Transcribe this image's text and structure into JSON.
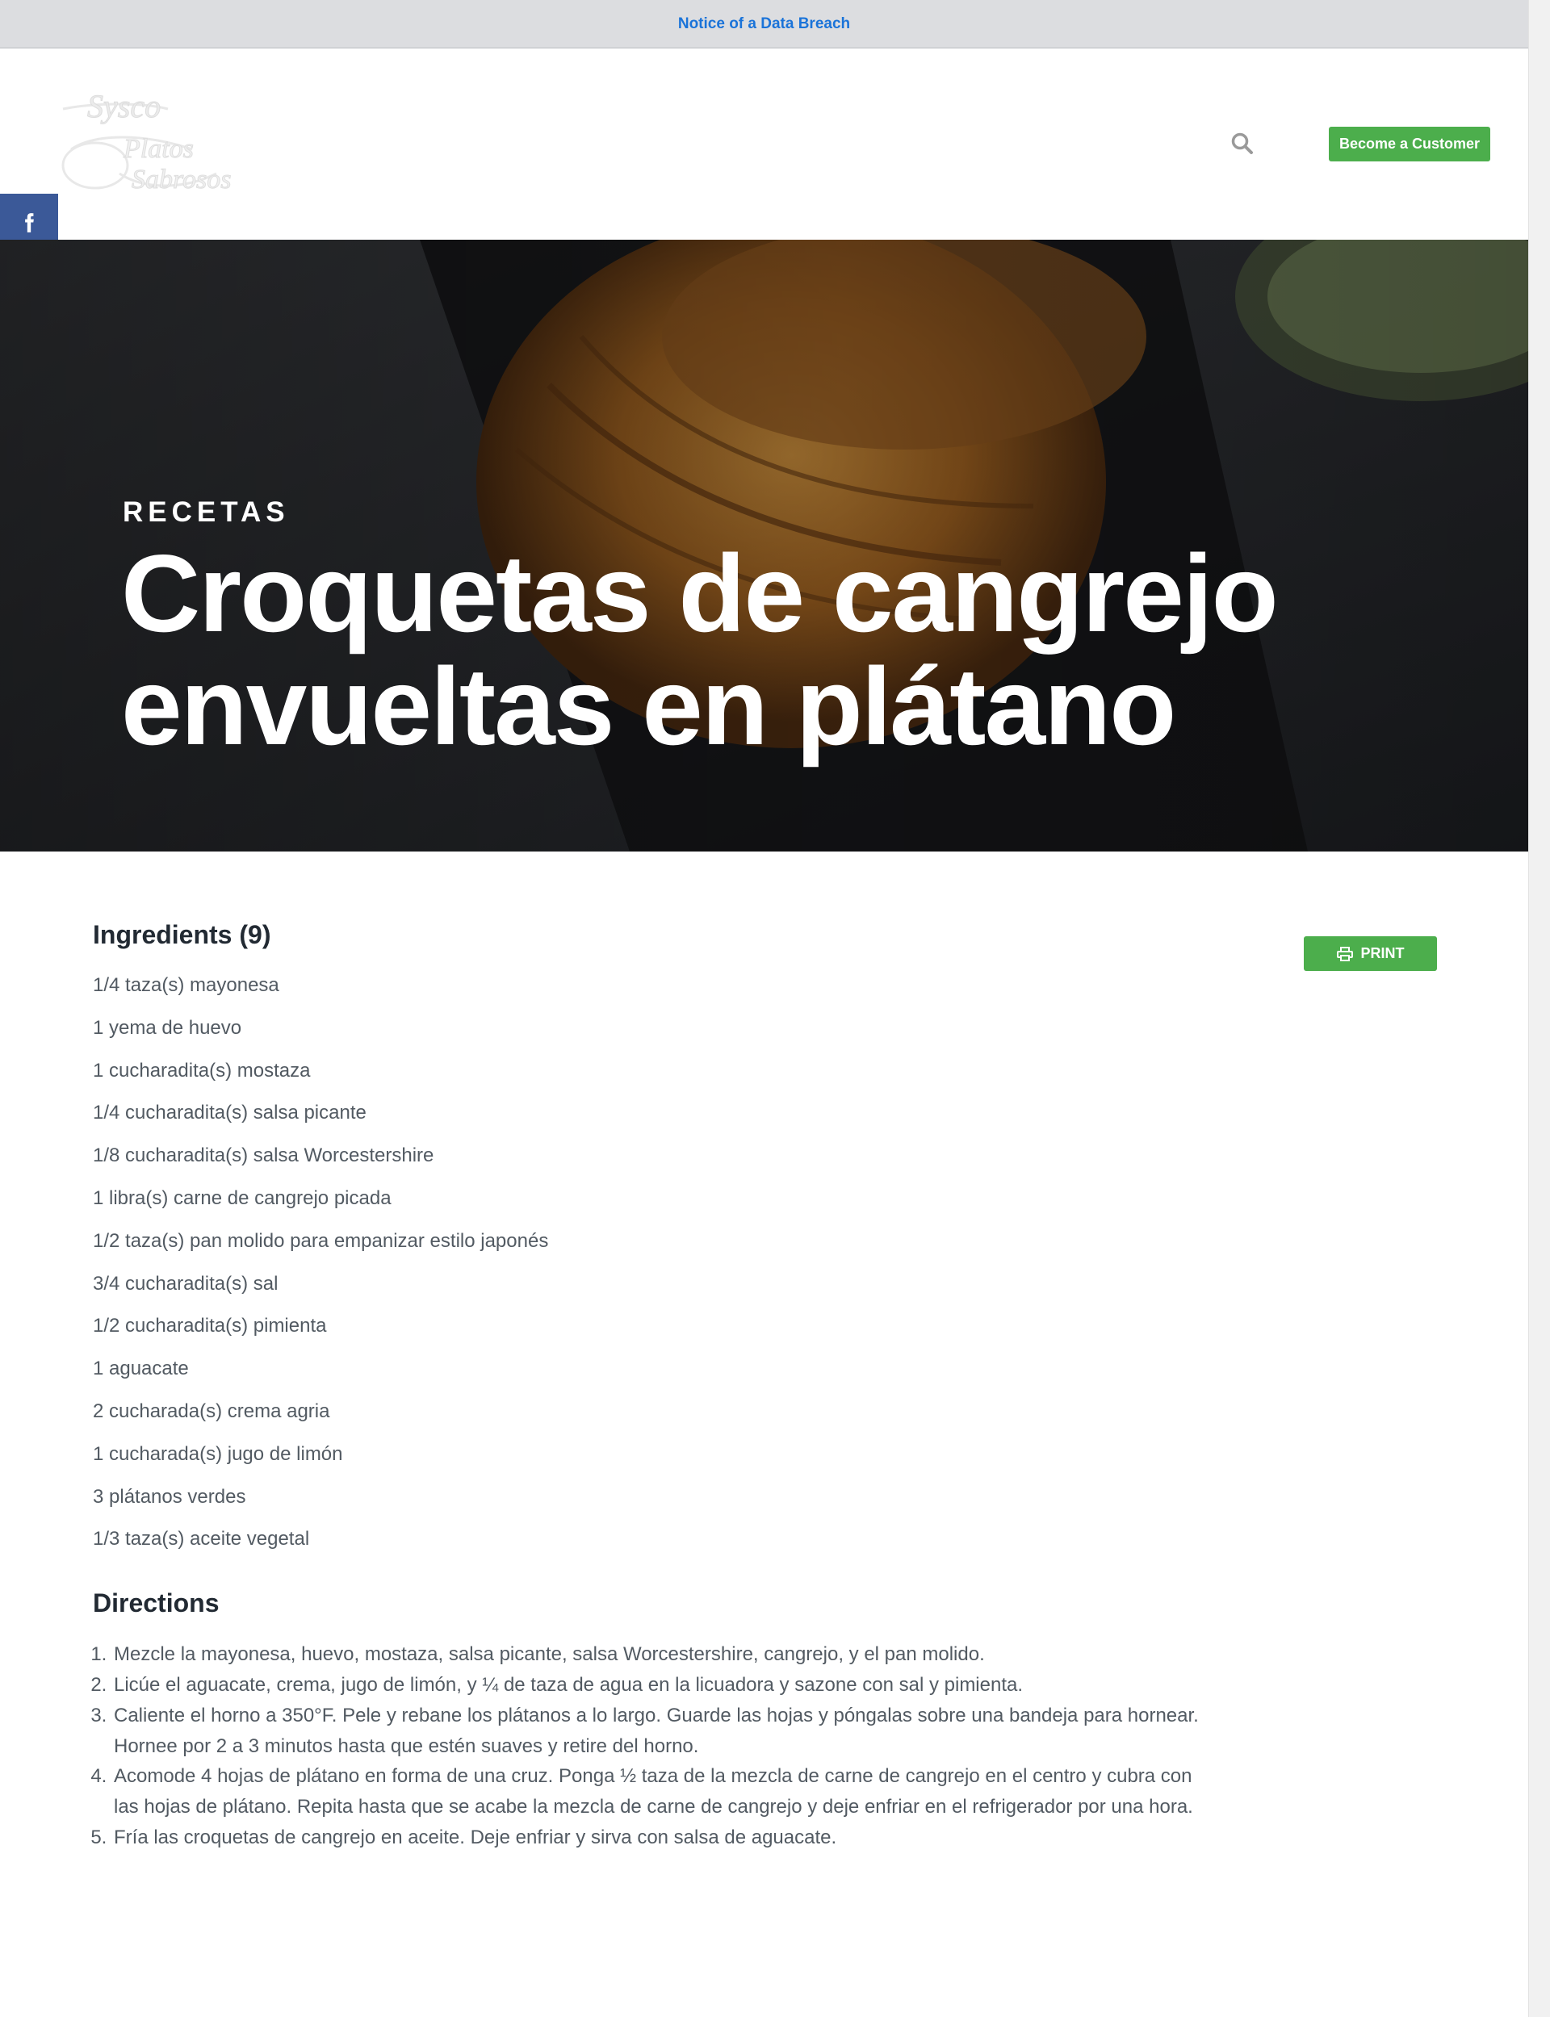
{
  "notice": {
    "link_text": "Notice of a Data Breach"
  },
  "header": {
    "cta_label": "Become a Customer"
  },
  "hero": {
    "eyebrow": "RECETAS",
    "title_line1": "Croquetas de cangrejo",
    "title_line2": "envueltas en plátano"
  },
  "social": {
    "icons": [
      "facebook-icon",
      "x-icon",
      "pinterest-icon",
      "email-icon",
      "share-icon"
    ]
  },
  "ingredients": {
    "title": "Ingredients (9)",
    "print_label": "PRINT",
    "items": [
      "1/4 taza(s) mayonesa",
      "1 yema de huevo",
      "1 cucharadita(s) mostaza",
      "1/4 cucharadita(s) salsa picante",
      "1/8 cucharadita(s) salsa Worcestershire",
      "1 libra(s) carne de cangrejo picada",
      "1/2 taza(s) pan molido para empanizar estilo japonés",
      "3/4 cucharadita(s) sal",
      "1/2 cucharadita(s) pimienta",
      "1 aguacate",
      "2 cucharada(s) crema agria",
      "1 cucharada(s) jugo de limón",
      "3 plátanos verdes",
      "1/3 taza(s) aceite vegetal"
    ]
  },
  "directions": {
    "title": "Directions",
    "steps": [
      "Mezcle la mayonesa, huevo, mostaza, salsa picante, salsa Worcestershire, cangrejo, y el pan molido.",
      "Licúe el aguacate, crema, jugo de limón, y ¼ de taza de agua en la licuadora y sazone con sal y pimienta.",
      "Caliente el horno a 350°F. Pele y rebane los plátanos a lo largo. Guarde las hojas y póngalas sobre una bandeja para hornear. Hornee por 2 a 3 minutos hasta que estén suaves y retire del horno.",
      "Acomode 4 hojas de plátano en forma de una cruz. Ponga ½ taza de la mezcla de carne de cangrejo en el centro y cubra con las hojas de plátano. Repita hasta que se acabe la mezcla de carne de cangrejo y deje enfriar en el refrigerador por una hora.",
      "Fría las croquetas de cangrejo en aceite. Deje enfriar y sirva con salsa de aguacate."
    ]
  },
  "colors": {
    "accent_green": "#4cae4c",
    "link_blue": "#1a73d9",
    "facebook": "#3b5998",
    "pinterest": "#cb2027",
    "share": "#95d03a"
  }
}
